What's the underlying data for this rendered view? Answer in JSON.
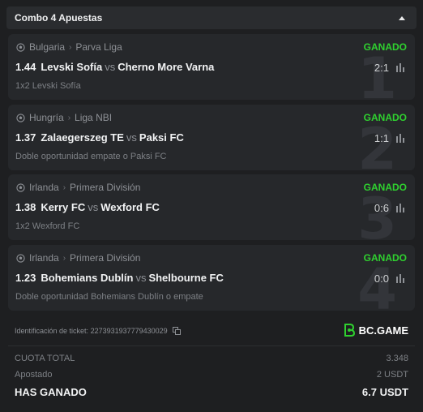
{
  "header": {
    "title": "Combo 4 Apuestas"
  },
  "bets": [
    {
      "country": "Bulgaria",
      "league": "Parva Liga",
      "status": "GANADO",
      "odds": "1.44",
      "home": "Levski Sofía",
      "vs": "vs",
      "away": "Cherno More Varna",
      "score": "2:1",
      "pick": "1x2 Levski Sofía",
      "number": "1"
    },
    {
      "country": "Hungría",
      "league": "Liga NBI",
      "status": "GANADO",
      "odds": "1.37",
      "home": "Zalaegerszeg TE",
      "vs": "vs",
      "away": "Paksi FC",
      "score": "1:1",
      "pick": "Doble oportunidad empate o Paksi FC",
      "number": "2"
    },
    {
      "country": "Irlanda",
      "league": "Primera División",
      "status": "GANADO",
      "odds": "1.38",
      "home": "Kerry FC",
      "vs": "vs",
      "away": "Wexford FC",
      "score": "0:6",
      "pick": "1x2 Wexford FC",
      "number": "3"
    },
    {
      "country": "Irlanda",
      "league": "Primera División",
      "status": "GANADO",
      "odds": "1.23",
      "home": "Bohemians Dublín",
      "vs": "vs",
      "away": "Shelbourne FC",
      "score": "0:0",
      "pick": "Doble oportunidad Bohemians Dublín o empate",
      "number": "4"
    }
  ],
  "ticket": {
    "label": "Identificación de ticket:",
    "id": "2273931937779430029"
  },
  "brand": {
    "name": "BC.GAME"
  },
  "summary": {
    "total_odds_label": "CUOTA TOTAL",
    "total_odds_value": "3.348",
    "staked_label": "Apostado",
    "staked_value": "2 USDT",
    "won_label": "HAS GANADO",
    "won_value": "6.7 USDT"
  },
  "colors": {
    "accent_green": "#2fd12f",
    "background": "#1e1f21",
    "card": "#26282b"
  }
}
